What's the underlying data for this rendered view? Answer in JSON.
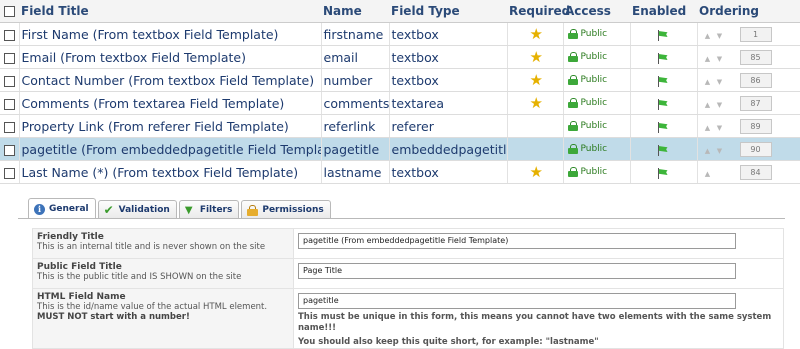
{
  "fields_table": {
    "headers": {
      "field_title": "Field Title",
      "name": "Name",
      "field_type": "Field Type",
      "required": "Required",
      "access": "Access",
      "enabled": "Enabled",
      "ordering": "Ordering"
    },
    "rows": [
      {
        "title": "First Name (From textbox Field Template)",
        "name": "firstname",
        "type": "textbox",
        "required": true,
        "access": "Public",
        "enabled": true,
        "order": "1",
        "selected": false
      },
      {
        "title": "Email (From textbox Field Template)",
        "name": "email",
        "type": "textbox",
        "required": true,
        "access": "Public",
        "enabled": true,
        "order": "85",
        "selected": false
      },
      {
        "title": "Contact Number (From textbox Field Template)",
        "name": "number",
        "type": "textbox",
        "required": true,
        "access": "Public",
        "enabled": true,
        "order": "86",
        "selected": false
      },
      {
        "title": "Comments (From textarea Field Template)",
        "name": "comments",
        "type": "textarea",
        "required": true,
        "access": "Public",
        "enabled": true,
        "order": "87",
        "selected": false
      },
      {
        "title": "Property Link (From referer Field Template)",
        "name": "referlink",
        "type": "referer",
        "required": false,
        "access": "Public",
        "enabled": true,
        "order": "89",
        "selected": false
      },
      {
        "title": "pagetitle (From embeddedpagetitle Field Template)",
        "name": "pagetitle",
        "type": "embeddedpagetitle",
        "required": false,
        "access": "Public",
        "enabled": true,
        "order": "90",
        "selected": true
      },
      {
        "title": "Last Name (*) (From textbox Field Template)",
        "name": "lastname",
        "type": "textbox",
        "required": true,
        "access": "Public",
        "enabled": true,
        "order": "84",
        "selected": false
      }
    ]
  },
  "tabs": [
    {
      "label": "General",
      "icon": "info-icon",
      "active": true
    },
    {
      "label": "Validation",
      "icon": "checkmark-icon",
      "active": false
    },
    {
      "label": "Filters",
      "icon": "filter-icon",
      "active": false
    },
    {
      "label": "Permissions",
      "icon": "lock-icon",
      "active": false
    }
  ],
  "form": {
    "friendly_title": {
      "label": "Friendly Title",
      "description": "This is an internal title and is never shown on the site",
      "value": "pagetitle (From embeddedpagetitle Field Template)"
    },
    "public_title": {
      "label": "Public Field Title",
      "description": "This is the public title and IS SHOWN on the site",
      "value": "Page Title"
    },
    "html_name": {
      "label": "HTML Field Name",
      "description": "This is the id/name value of the actual HTML element.",
      "warning": "MUST NOT start with a number!",
      "value": "pagetitle",
      "note_1": "This must be unique in this form, this means you cannot have two elements with the same system name!!!",
      "note_2": "You should also keep this quite short, for example: \"lastname\""
    }
  },
  "colors": {
    "header_text": "#2b4a78",
    "row_text": "#1d3a6e",
    "selected_row": "#c0dbe9",
    "public_green": "#2a7a1d",
    "star": "#e6b100"
  }
}
